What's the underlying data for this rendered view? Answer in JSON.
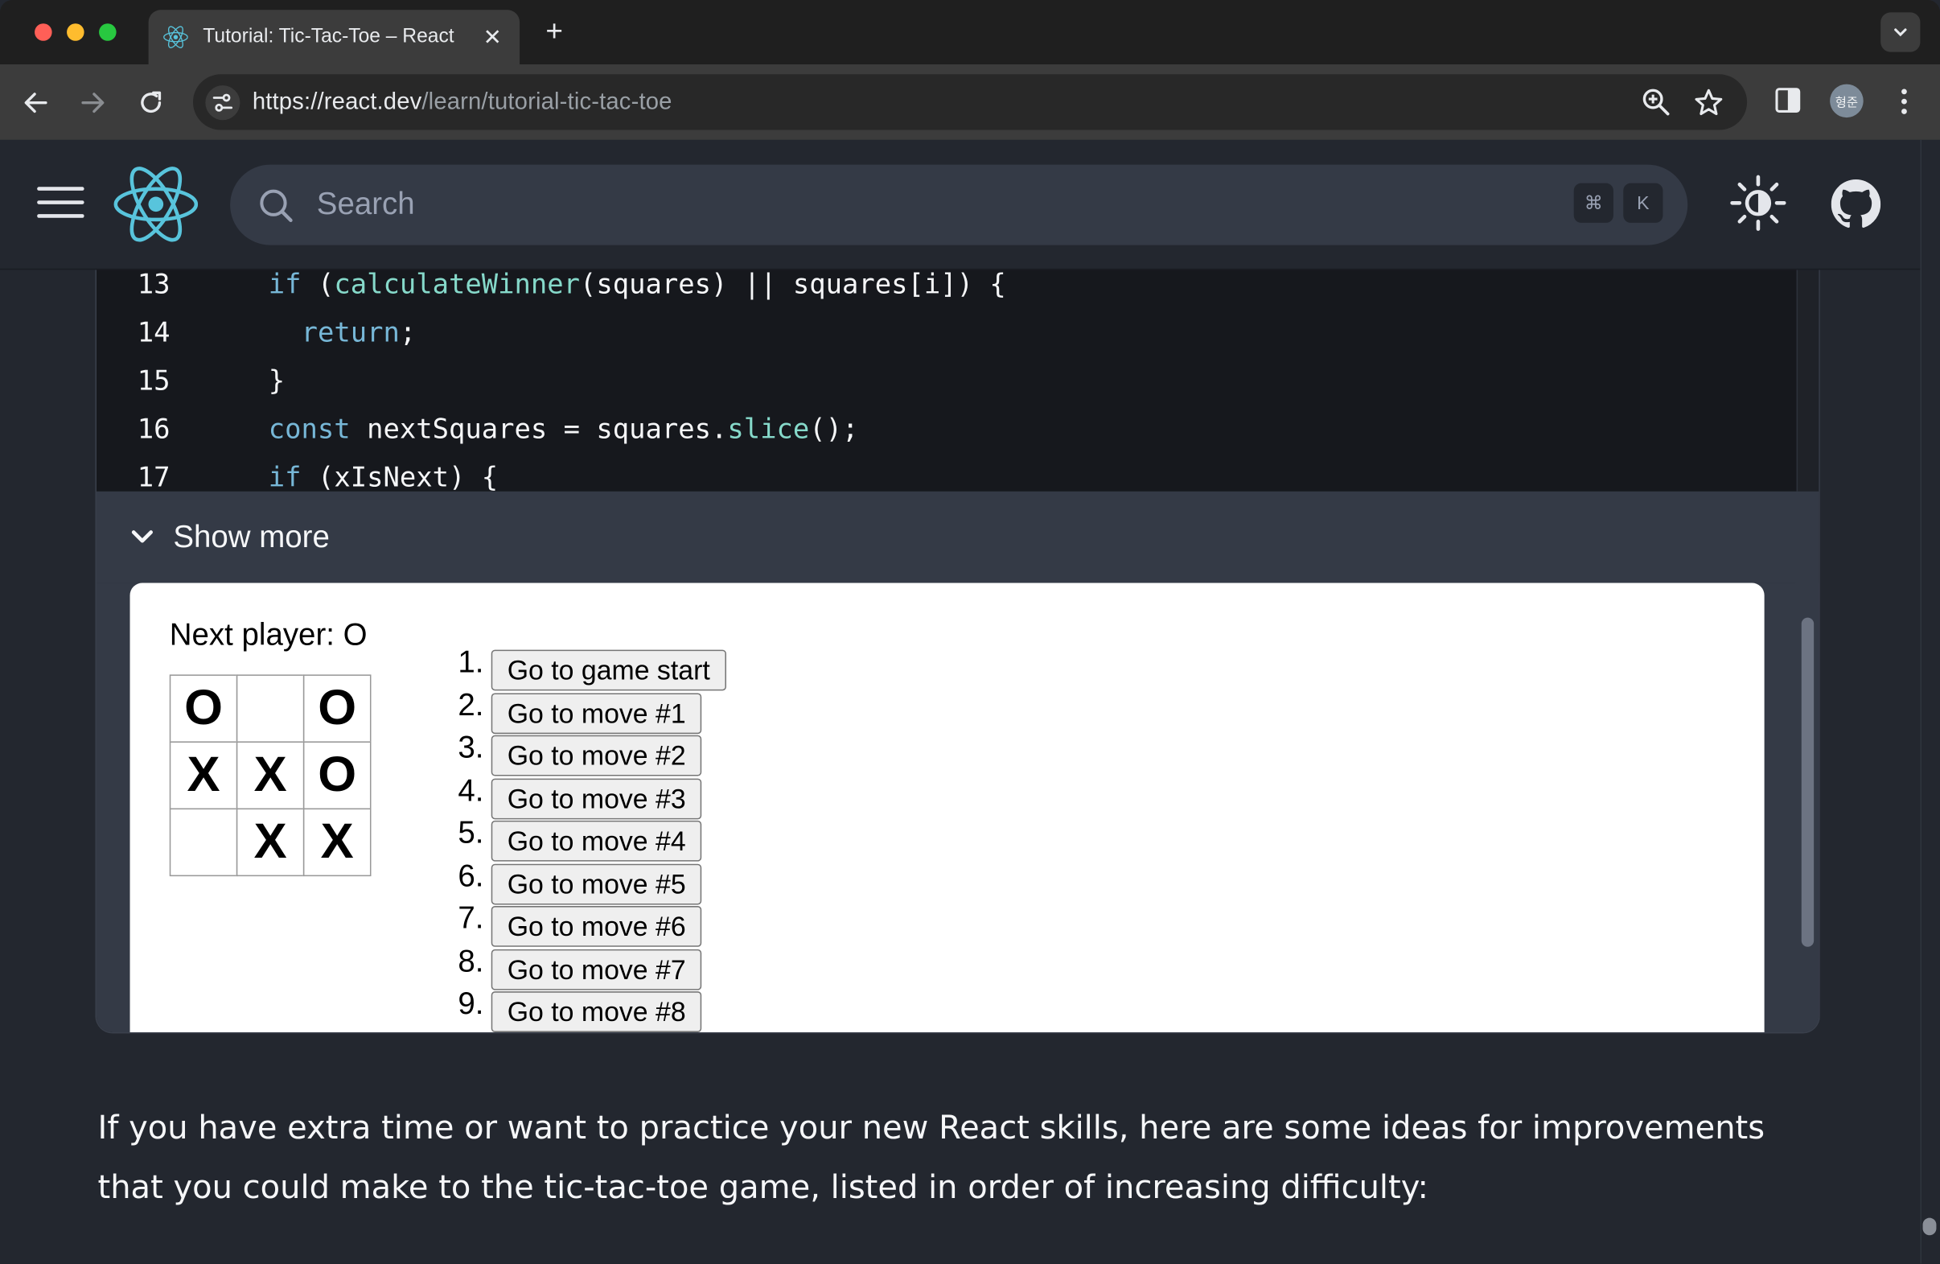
{
  "browser": {
    "tab_title": "Tutorial: Tic-Tac-Toe – React",
    "close_glyph": "✕",
    "new_tab_glyph": "+",
    "url_host": "https://react.dev",
    "url_path": "/learn/tutorial-tic-tac-toe",
    "profile_initials": "형준",
    "icons": [
      "react-favicon",
      "tab-search-icon",
      "back-icon",
      "forward-icon",
      "reload-icon",
      "site-info-icon",
      "zoom-icon",
      "bookmark-star-icon",
      "side-panel-icon",
      "more-menu-icon"
    ]
  },
  "site_header": {
    "search_placeholder": "Search",
    "shortcut_cmd": "⌘",
    "shortcut_key": "K",
    "icons": [
      "hamburger-icon",
      "react-logo",
      "search-icon",
      "theme-toggle-icon",
      "github-icon"
    ]
  },
  "code": {
    "lines": [
      {
        "num": "13",
        "indent": "",
        "tokens": [
          [
            "kw",
            "if"
          ],
          [
            "pl",
            " ("
          ],
          [
            "fn",
            "calculateWinner"
          ],
          [
            "pl",
            "(squares) || squares[i]) {"
          ]
        ]
      },
      {
        "num": "14",
        "indent": "  ",
        "tokens": [
          [
            "kw",
            "return"
          ],
          [
            "pl",
            ";"
          ]
        ]
      },
      {
        "num": "15",
        "indent": "",
        "tokens": [
          [
            "pl",
            "}"
          ]
        ]
      },
      {
        "num": "16",
        "indent": "",
        "tokens": [
          [
            "kw",
            "const"
          ],
          [
            "pl",
            " nextSquares = squares."
          ],
          [
            "fn",
            "slice"
          ],
          [
            "pl",
            "();"
          ]
        ]
      },
      {
        "num": "17",
        "indent": "",
        "tokens": [
          [
            "kw",
            "if"
          ],
          [
            "pl",
            " (xIsNext) {"
          ]
        ]
      }
    ]
  },
  "show_more": {
    "label": "Show more"
  },
  "game": {
    "status": "Next player: O",
    "squares": [
      "O",
      "",
      "O",
      "X",
      "X",
      "O",
      "",
      "X",
      "X"
    ],
    "moves": [
      {
        "num": "1.",
        "label": "Go to game start"
      },
      {
        "num": "2.",
        "label": "Go to move #1"
      },
      {
        "num": "3.",
        "label": "Go to move #2"
      },
      {
        "num": "4.",
        "label": "Go to move #3"
      },
      {
        "num": "5.",
        "label": "Go to move #4"
      },
      {
        "num": "6.",
        "label": "Go to move #5"
      },
      {
        "num": "7.",
        "label": "Go to move #6"
      },
      {
        "num": "8.",
        "label": "Go to move #7"
      },
      {
        "num": "9.",
        "label": "Go to move #8"
      }
    ]
  },
  "prose": {
    "paragraph": "If you have extra time or want to practice your new React skills, here are some ideas for improvements that you could make to the tic-tac-toe game, listed in order of increasing difficulty:"
  },
  "colors": {
    "page_bg": "#23272f",
    "code_bg": "#16181d",
    "keyword": "#77b7d7",
    "function": "#86d9ca",
    "react_blue": "#58c4dc"
  }
}
